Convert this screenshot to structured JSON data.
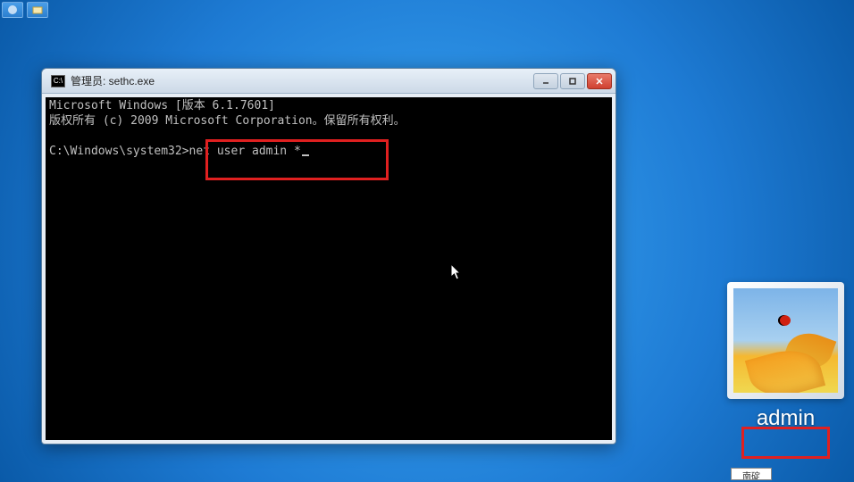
{
  "taskbar": {
    "icons": [
      "start-orb-icon",
      "explorer-icon"
    ]
  },
  "cmd_window": {
    "title": "管理员: sethc.exe",
    "controls": {
      "minimize": "minimize-icon",
      "maximize": "maximize-icon",
      "close": "close-icon"
    },
    "terminal": {
      "header1": "Microsoft Windows [版本 6.1.7601]",
      "header2": "版权所有 (c) 2009 Microsoft Corporation。保留所有权利。",
      "prompt": "C:\\Windows\\system32>",
      "command": "net user admin *"
    }
  },
  "user_tile": {
    "username": "admin",
    "avatar": "flower-ladybug"
  },
  "bottom_widget": {
    "label": "南碇"
  },
  "annotations": {
    "highlight_color": "#e02020"
  }
}
